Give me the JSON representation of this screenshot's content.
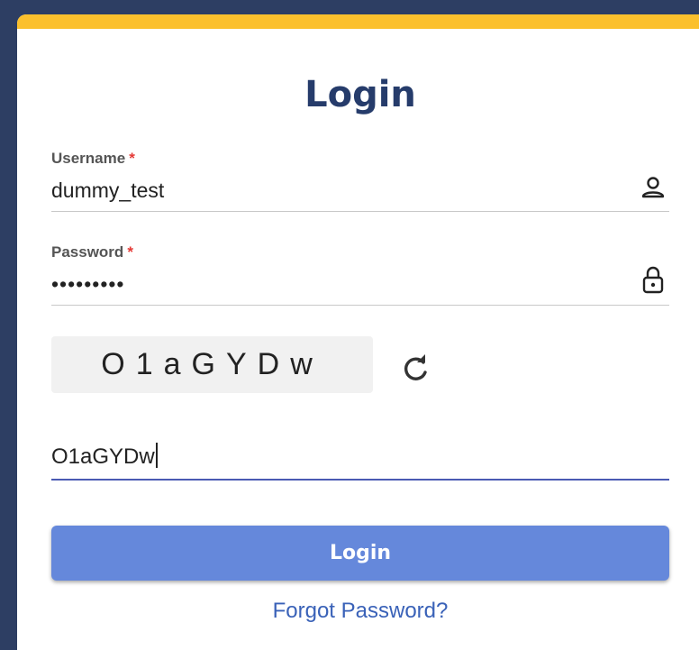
{
  "title": "Login",
  "username": {
    "label": "Username",
    "required_mark": "*",
    "value": "dummy_test",
    "icon": "user-icon"
  },
  "password": {
    "label": "Password",
    "required_mark": "*",
    "value": "•••••••••",
    "icon": "lock-icon"
  },
  "captcha": {
    "text": "O1aGYDw",
    "refresh_icon": "refresh-icon",
    "input_value": "O1aGYDw"
  },
  "login_button": "Login",
  "forgot_link": "Forgot Password?",
  "colors": {
    "accent_bar": "#fbc02d",
    "background": "#2d3e63",
    "button": "#6588db",
    "title": "#263c6b",
    "link": "#3a62b8"
  }
}
